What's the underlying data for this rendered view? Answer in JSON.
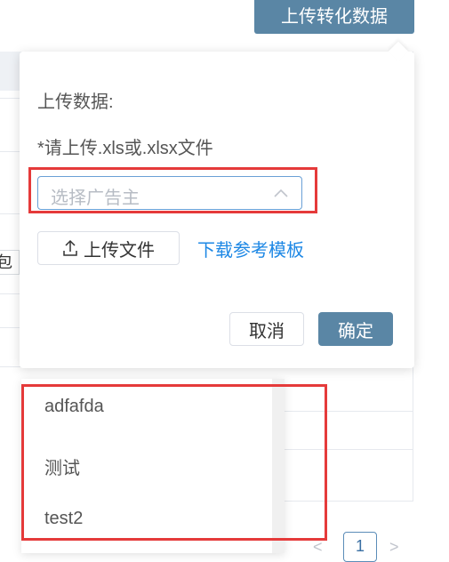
{
  "header": {
    "upload_convert_label": "上传转化数据"
  },
  "popover": {
    "title": "上传数据:",
    "hint": "*请上传.xls或.xlsx文件",
    "advertiser_placeholder": "选择广告主",
    "upload_label": "上传文件",
    "download_link": "下载参考模板",
    "cancel_label": "取消",
    "confirm_label": "确定"
  },
  "dropdown": {
    "options": [
      "adfafda",
      "测试",
      "test2"
    ]
  },
  "background": {
    "fragment_text": "包含"
  },
  "pagination": {
    "current_page": "1",
    "prev": "<",
    "next": ">"
  },
  "colors": {
    "primary": "#5a86a5",
    "link": "#1e88e5",
    "annotation": "#e53a3a"
  }
}
